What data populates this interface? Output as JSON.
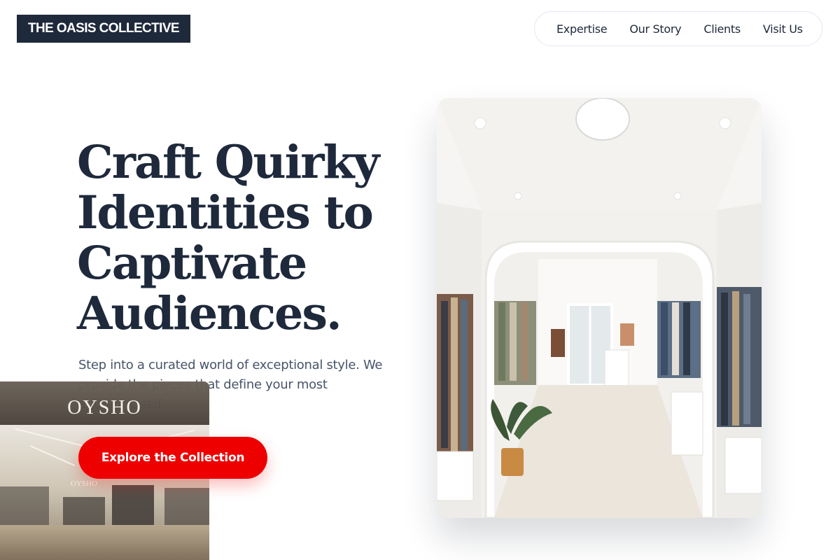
{
  "header": {
    "logo": "THE OASIS COLLECTIVE",
    "nav": [
      "Expertise",
      "Our Story",
      "Clients",
      "Visit Us"
    ]
  },
  "hero": {
    "title_lines": [
      "Craft Quirky",
      "Identities to",
      "Captivate",
      "Audiences."
    ],
    "subtitle": "Step into a curated world of exceptional style. We provide the pieces that define your most authentic self.",
    "cta": "Explore the Collection"
  },
  "side_photo": {
    "store_sign": "OYSHO",
    "store_sign_small": "OYSHO"
  },
  "icons": {
    "main_photo": "boutique-interior-photo",
    "side_photo": "storefront-photo"
  }
}
